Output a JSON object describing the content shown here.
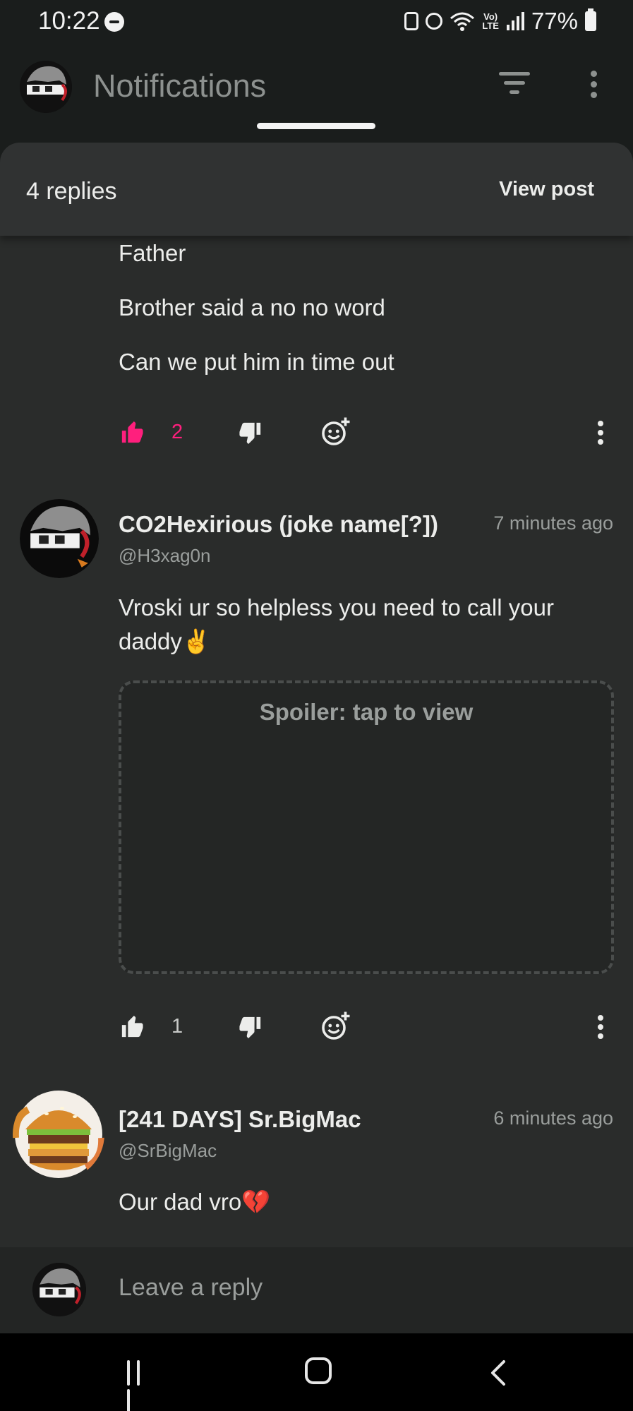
{
  "status_bar": {
    "time": "10:22",
    "lte_top": "Vo)",
    "lte_bottom": "LTE",
    "battery": "77%"
  },
  "header": {
    "title": "Notifications"
  },
  "sheet": {
    "replies_count": "4 replies",
    "view_post": "View post"
  },
  "first_comment": {
    "lines": [
      "Father",
      "Brother said a no no word",
      "Can we put him in time out"
    ],
    "likes": "2",
    "liked_color": "#ff1f7d"
  },
  "comments": [
    {
      "author": "CO2Hexirious (joke name[?])",
      "handle": "@H3xag0n",
      "time": "7 minutes ago",
      "body_line1": "Vroski ur so helpless you need to call your",
      "body_line2": "daddy✌️",
      "spoiler": "Spoiler: tap to view",
      "likes": "1"
    },
    {
      "author": "[241 DAYS] Sr.BigMac",
      "handle": "@SrBigMac",
      "time": "6 minutes ago",
      "body": "Our dad vro💔"
    }
  ],
  "reply_bar": {
    "placeholder": "Leave a reply"
  },
  "colors": {
    "background": "#1a1d1c",
    "sheet": "#2a2c2b",
    "accent_pink": "#ff1f7d"
  }
}
